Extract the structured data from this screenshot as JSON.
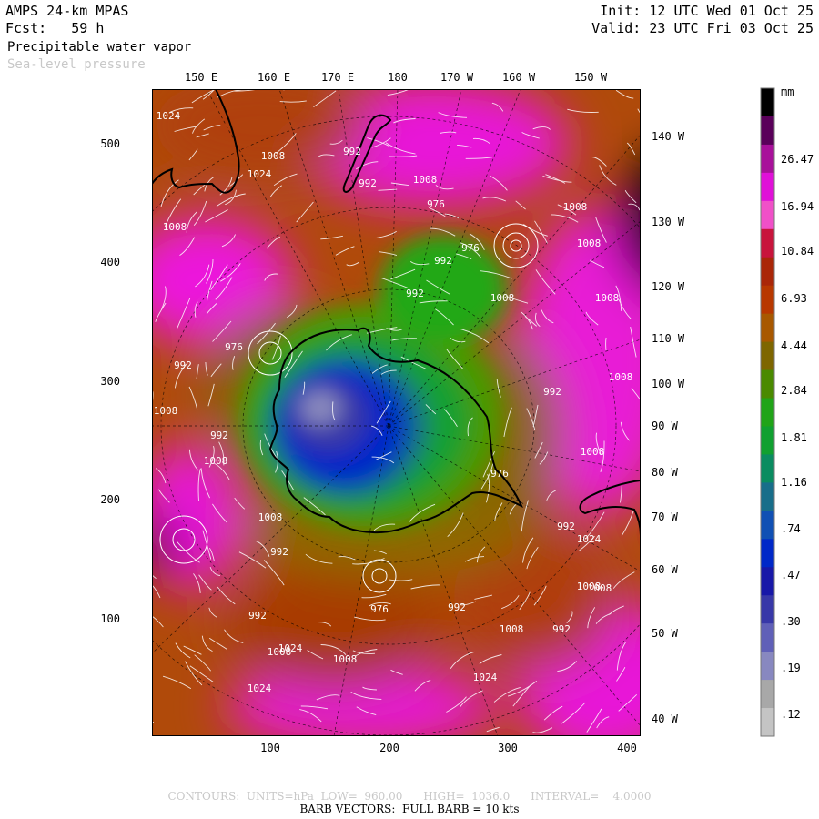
{
  "header": {
    "model": "AMPS 24-km MPAS",
    "fcst_label": "Fcst:",
    "fcst_value": "59 h",
    "field": "Precipitable water vapor",
    "overlay": "Sea-level pressure",
    "init": "Init: 12 UTC Wed 01 Oct 25",
    "valid": "Valid: 23 UTC Fri 03 Oct 25"
  },
  "top_longitudes": [
    "150 E",
    "160 E",
    "170 E",
    "180",
    "170 W",
    "160 W",
    "150 W"
  ],
  "right_longitudes": [
    "140 W",
    "130 W",
    "120 W",
    "110 W",
    "100 W",
    "90 W",
    "80 W",
    "70 W",
    "60 W",
    "50 W",
    "40 W"
  ],
  "grid_axes": {
    "x_ticks": [
      "100",
      "200",
      "300",
      "400"
    ],
    "y_ticks": [
      "500",
      "400",
      "300",
      "200",
      "100"
    ]
  },
  "colorbar": {
    "unit": "mm",
    "labels": [
      "26.47",
      "16.94",
      "10.84",
      "6.93",
      "4.44",
      "2.84",
      "1.81",
      "1.16",
      ".74",
      ".47",
      ".30",
      ".19",
      ".12"
    ],
    "colors": [
      "#000000",
      "#5a005a",
      "#a8109a",
      "#e010d8",
      "#f050c8",
      "#c8143c",
      "#aa2608",
      "#b83800",
      "#a85800",
      "#7e6600",
      "#4a8a00",
      "#20a418",
      "#10a030",
      "#0a8c60",
      "#186e8a",
      "#1050b4",
      "#0028c8",
      "#1818a8",
      "#3838a8",
      "#6060b8",
      "#8888c0",
      "#a8a8a8",
      "#c4c4c4"
    ]
  },
  "pressure_labels": [
    "1024",
    "1008",
    "992",
    "1008",
    "1024",
    "1008",
    "992",
    "976",
    "992",
    "1008",
    "1008",
    "1008",
    "976",
    "1008",
    "992",
    "976",
    "992",
    "1008",
    "992",
    "1008",
    "1008",
    "1008",
    "992",
    "992",
    "1008",
    "1024",
    "1008",
    "992",
    "976",
    "992",
    "1008",
    "1024",
    "1008",
    "1024",
    "1008",
    "992",
    "1024",
    "992",
    "1008",
    "976"
  ],
  "footer": {
    "contours": "CONTOURS:  UNITS=hPa  LOW=  960.00      HIGH=  1036.0      INTERVAL=    4.0000",
    "barbs": "BARB VECTORS:  FULL BARB = 10 kts"
  }
}
